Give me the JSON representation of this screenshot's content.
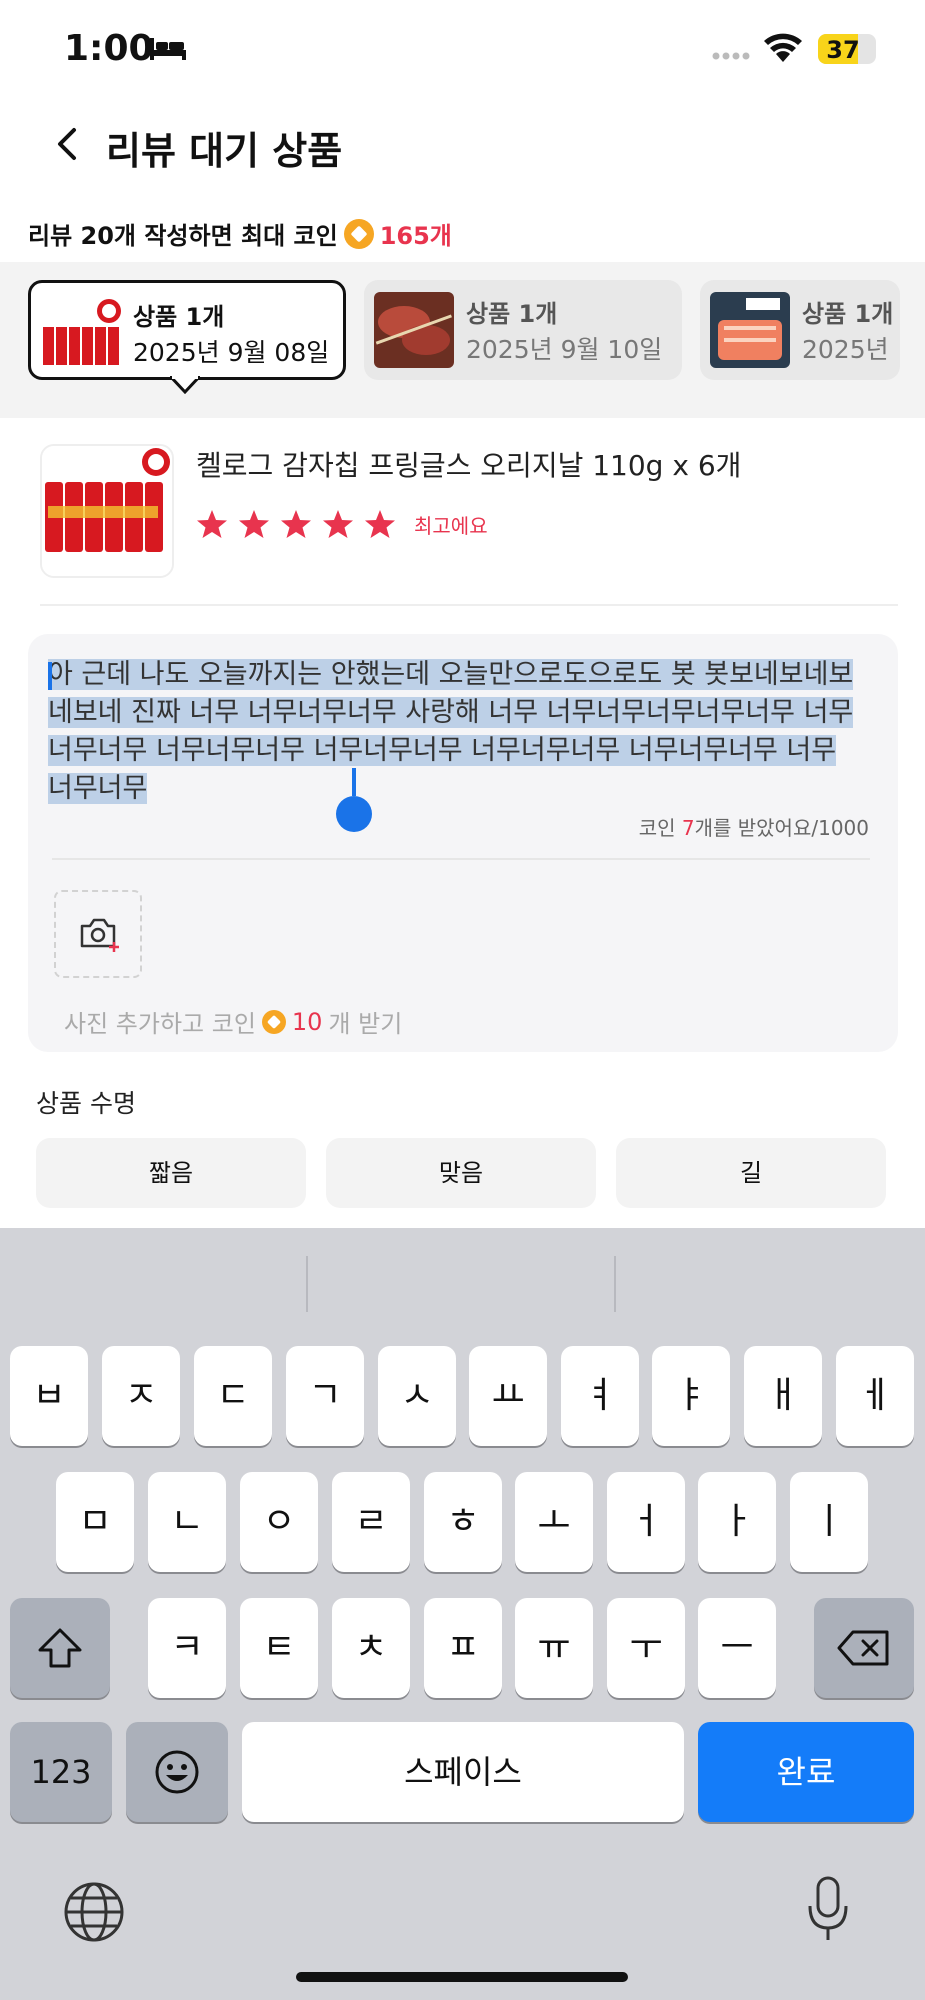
{
  "status_bar": {
    "time": "1:00",
    "battery": "37"
  },
  "header": {
    "title": "리뷰 대기 상품"
  },
  "promo": {
    "text": "리뷰 20개 작성하면 최대 코인",
    "count": "165개"
  },
  "tabs": [
    {
      "title": "상품 1개",
      "date": "2025년 9월 08일",
      "active": true
    },
    {
      "title": "상품 1개",
      "date": "2025년 9월 10일",
      "active": false
    },
    {
      "title": "상품 1개",
      "date": "2025년",
      "active": false
    }
  ],
  "product": {
    "name": "켈로그 감자칩 프링글스 오리지날 110g x 6개",
    "stars": 5,
    "rating_label": "최고에요"
  },
  "review": {
    "text": "아 근데 나도 오늘까지는 안했는데 오늘만으로도으로도 봇 봇보네보네보네보네 진짜 너무 너무너무너무 사랑해 너무 너무너무너무너무너무 너무너무너무 너무너무너무 너무너무너무 너무너무너무 너무너무너무 너무너무너무",
    "coin_prefix": "코인",
    "coin_count": "7",
    "coin_suffix": "개를 받았어요/1000",
    "photo_prefix": "사진 추가하고 코인",
    "photo_count": "10",
    "photo_suffix": "개 받기"
  },
  "size": {
    "label": "상품 수명",
    "options": [
      "짧음",
      "맞음",
      "길"
    ]
  },
  "keyboard": {
    "row1": [
      "ㅂ",
      "ㅈ",
      "ㄷ",
      "ㄱ",
      "ㅅ",
      "ㅛ",
      "ㅕ",
      "ㅑ",
      "ㅐ",
      "ㅔ"
    ],
    "row2": [
      "ㅁ",
      "ㄴ",
      "ㅇ",
      "ㄹ",
      "ㅎ",
      "ㅗ",
      "ㅓ",
      "ㅏ",
      "ㅣ"
    ],
    "row3": [
      "ㅋ",
      "ㅌ",
      "ㅊ",
      "ㅍ",
      "ㅠ",
      "ㅜ",
      "ㅡ"
    ],
    "numbers": "123",
    "space": "스페이스",
    "done": "완료"
  },
  "colors": {
    "accent": "#e8344e",
    "coin": "#f6a623",
    "keyboard_blue": "#147cf9",
    "selection": "#bdd0e7"
  }
}
